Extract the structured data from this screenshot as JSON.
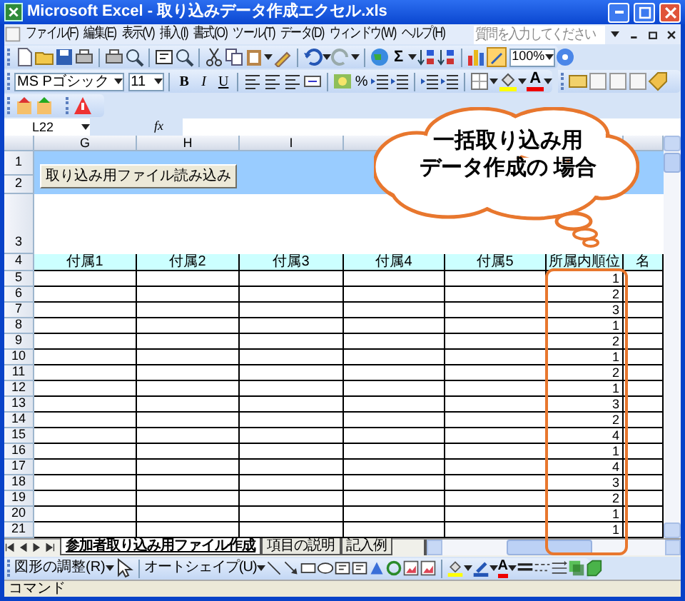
{
  "window": {
    "title": "Microsoft Excel - 取り込みデータ作成エクセル.xls"
  },
  "menu_bar": {
    "items": [
      "ファイル(F)",
      "編集(E)",
      "表示(V)",
      "挿入(I)",
      "書式(O)",
      "ツール(T)",
      "データ(D)",
      "ウィンドウ(W)",
      "ヘルプ(H)"
    ],
    "help_placeholder": "質問を入力してください"
  },
  "standard_toolbar": {
    "sum": "Σ",
    "zoom": "100%"
  },
  "formatting_toolbar": {
    "font": "MS Pゴシック",
    "size": "11",
    "styles": [
      "B",
      "I",
      "U"
    ],
    "percent": "%",
    "font_color": "A"
  },
  "formula_bar": {
    "name_box": "L22",
    "fx": "fx"
  },
  "sheet": {
    "column_headers": [
      "G",
      "H",
      "I"
    ],
    "row_numbers": [
      "1",
      "2",
      "3",
      "4",
      "5",
      "6",
      "7",
      "8",
      "9",
      "10",
      "11",
      "12",
      "13",
      "14",
      "15",
      "16",
      "17",
      "18",
      "19",
      "20",
      "21"
    ],
    "import_button": "取り込み用ファイル読み込み",
    "header_row": [
      "付属1",
      "付属2",
      "付属3",
      "付属4",
      "付属5",
      "所属内順位",
      "名"
    ],
    "rank_values": [
      "1",
      "2",
      "3",
      "1",
      "2",
      "1",
      "2",
      "1",
      "3",
      "2",
      "4",
      "1",
      "4",
      "3",
      "2",
      "1",
      "1"
    ]
  },
  "callout": {
    "lines": [
      "一括取り込み用",
      "データ作成の 場合"
    ]
  },
  "sheet_tabs": [
    {
      "label": "参加者取り込み用ファイル作成",
      "selected": true
    },
    {
      "label": "項目の説明",
      "selected": false
    },
    {
      "label": "記入例",
      "selected": false
    }
  ],
  "drawing_toolbar": {
    "draw_menu": "図形の調整(R)",
    "autoshapes": "オートシェイプ(U)",
    "font_color": "A"
  },
  "status_bar": {
    "text": "コマンド"
  }
}
